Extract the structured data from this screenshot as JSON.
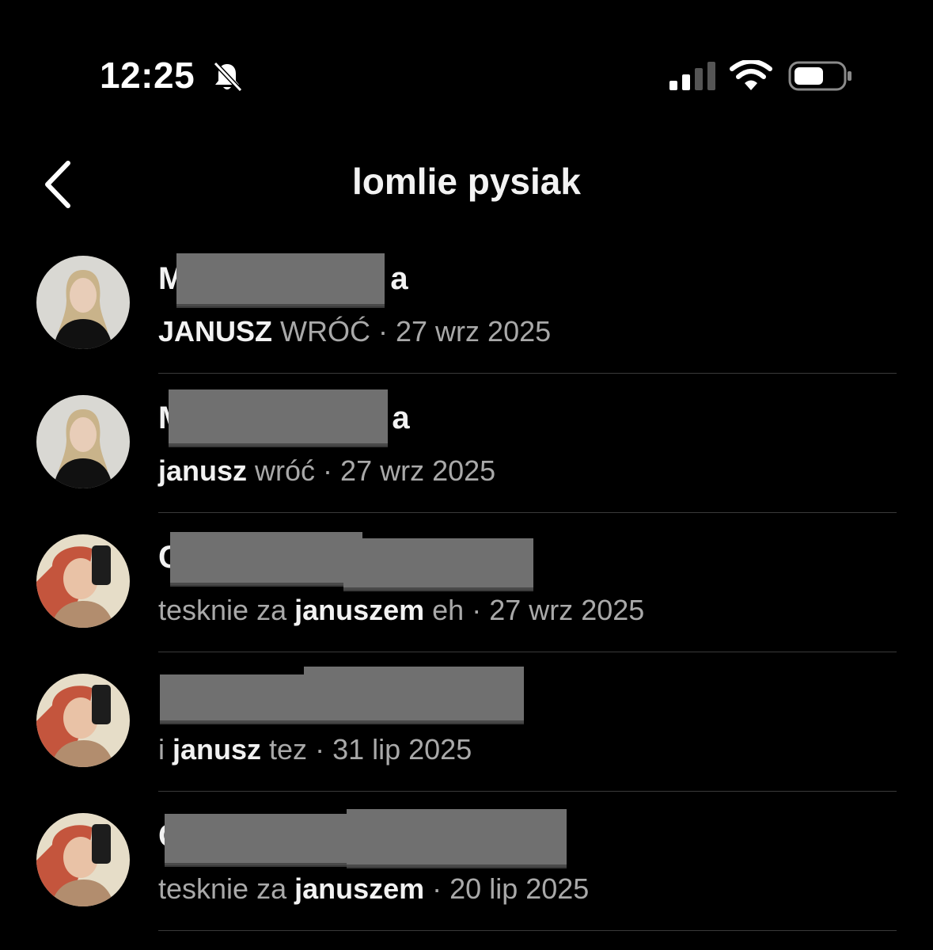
{
  "status_bar": {
    "time": "12:25"
  },
  "header": {
    "title": "lomlie pysiak"
  },
  "conversations": [
    {
      "name_start": "M",
      "name_end": "a",
      "sub_pre": "",
      "sub_bold": "JANUSZ",
      "sub_post": " WRÓĆ",
      "date": "27 wrz 2025",
      "avatar": "avatar-blonde"
    },
    {
      "name_start": "M",
      "name_end": "a",
      "sub_pre": "",
      "sub_bold": "janusz",
      "sub_post": " wróć",
      "date": "27 wrz 2025",
      "avatar": "avatar-blonde"
    },
    {
      "name_start": "C",
      "name_end": "",
      "sub_pre": "tesknie za ",
      "sub_bold": "januszem",
      "sub_post": " eh",
      "date": "27 wrz 2025",
      "avatar": "avatar-redhair"
    },
    {
      "name_start": "",
      "name_end": "",
      "sub_pre": "i ",
      "sub_bold": "janusz",
      "sub_post": " tez",
      "date": "31 lip 2025",
      "avatar": "avatar-redhair"
    },
    {
      "name_start": "C",
      "name_end": "",
      "sub_pre": "tesknie za ",
      "sub_bold": "januszem",
      "sub_post": "",
      "date": "20 lip 2025",
      "avatar": "avatar-redhair"
    }
  ]
}
